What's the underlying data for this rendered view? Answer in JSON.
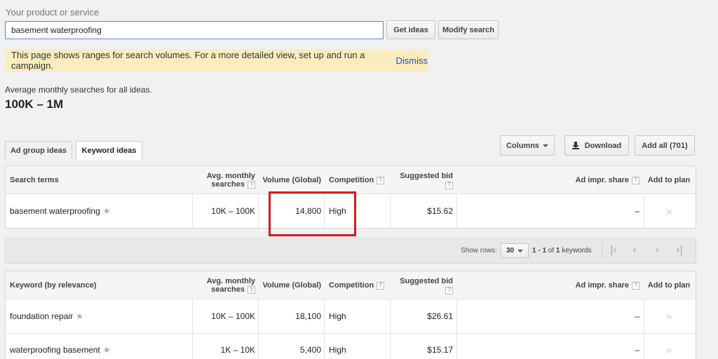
{
  "search": {
    "label": "Your product or service",
    "value": "basement waterproofing",
    "get_ideas": "Get ideas",
    "modify": "Modify search"
  },
  "notice": {
    "text": "This page shows ranges for search volumes. For a more detailed view, set up and run a campaign.",
    "dismiss": "Dismiss"
  },
  "summary": {
    "label": "Average monthly searches for all ideas.",
    "value": "100K – 1M"
  },
  "tabs": [
    "Ad group ideas",
    "Keyword ideas"
  ],
  "toolbar": {
    "columns": "Columns",
    "download": "Download",
    "add_all": "Add all (701)"
  },
  "table1": {
    "headers": {
      "term": "Search terms",
      "avg1": "Avg. monthly",
      "avg2": "searches",
      "volume": "Volume (Global)",
      "competition": "Competition",
      "bid1": "Suggested bid",
      "impr": "Ad impr. share",
      "add": "Add to plan"
    },
    "rows": [
      {
        "term": "basement waterproofing",
        "avg": "10K – 100K",
        "volume": "14,800",
        "competition": "High",
        "bid": "$15.62",
        "impr": "–",
        "add": "»"
      }
    ]
  },
  "pager": {
    "show_rows": "Show rows:",
    "rows_value": "30",
    "count_range": "1 - 1",
    "count_of": "of",
    "count_total": "1",
    "count_unit": "keywords"
  },
  "table2": {
    "headers": {
      "term": "Keyword (by relevance)",
      "avg1": "Avg. monthly",
      "avg2": "searches",
      "volume": "Volume (Global)",
      "competition": "Competition",
      "bid1": "Suggested bid",
      "impr": "Ad impr. share",
      "add": "Add to plan"
    },
    "rows": [
      {
        "term": "foundation repair",
        "avg": "10K – 100K",
        "volume": "18,100",
        "competition": "High",
        "bid": "$26.61",
        "impr": "–",
        "add": "»"
      },
      {
        "term": "waterproofing basement",
        "avg": "1K – 10K",
        "volume": "5,400",
        "competition": "High",
        "bid": "$15.17",
        "impr": "–",
        "add": "»"
      }
    ]
  },
  "colors": {
    "highlight": "#d9191f",
    "input_border": "#4d90fe",
    "notice_bg": "#f9edbe",
    "link": "#1155cc"
  }
}
